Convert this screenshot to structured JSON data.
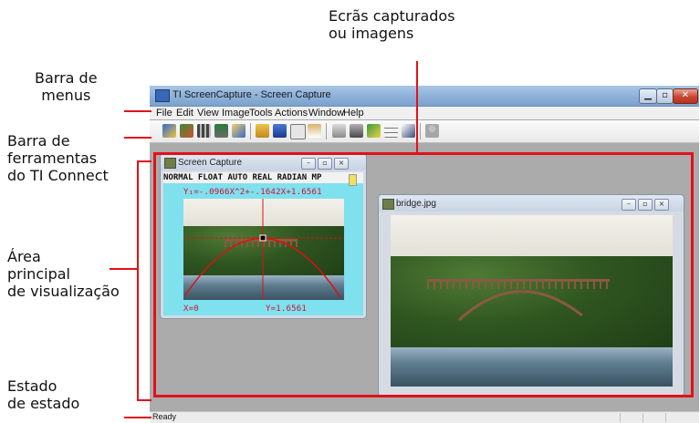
{
  "callouts": {
    "captured": "Ecrãs capturados\nou imagens",
    "captured_line1": "Ecrãs capturados",
    "captured_line2": "ou imagens",
    "menubar_line1": "Barra de",
    "menubar_line2": "menus",
    "toolbar_line1": "Barra de",
    "toolbar_line2": "ferramentas",
    "toolbar_line3": "do TI Connect",
    "viewarea_line1": "Área",
    "viewarea_line2": "principal",
    "viewarea_line3": "de visualização",
    "status_line1": "Estado",
    "status_line2": "de estado"
  },
  "colors": {
    "callout_red": "#e2101a",
    "lcd_bg": "#7fe0ee",
    "lcd_text": "#d01030"
  },
  "app": {
    "title": "TI ScreenCapture - Screen Capture",
    "menu": [
      "File",
      "Edit",
      "View",
      "Image",
      "Tools",
      "Actions",
      "Window",
      "Help"
    ],
    "toolbar_icons": [
      "new-capture-icon",
      "screen-capture-icon",
      "film-icon",
      "multi-capture-icon",
      "device-explorer-icon",
      "open-folder-icon",
      "save-disk-icon",
      "copy-icon",
      "paste-icon",
      "print-icon",
      "camera-icon",
      "send-to-device-icon",
      "grid-icon",
      "edit-icon",
      "user-icon"
    ],
    "status": "Ready"
  },
  "capture_window": {
    "title": "Screen Capture",
    "mode_line": "NORMAL FLOAT AUTO REAL RADIAN MP",
    "equation": "Y₁=-.0966X^2+-.1642X+1.6561",
    "x_label": "X=0",
    "y_label": "Y=1.6561"
  },
  "bridge_window": {
    "title": "bridge.jpg"
  }
}
